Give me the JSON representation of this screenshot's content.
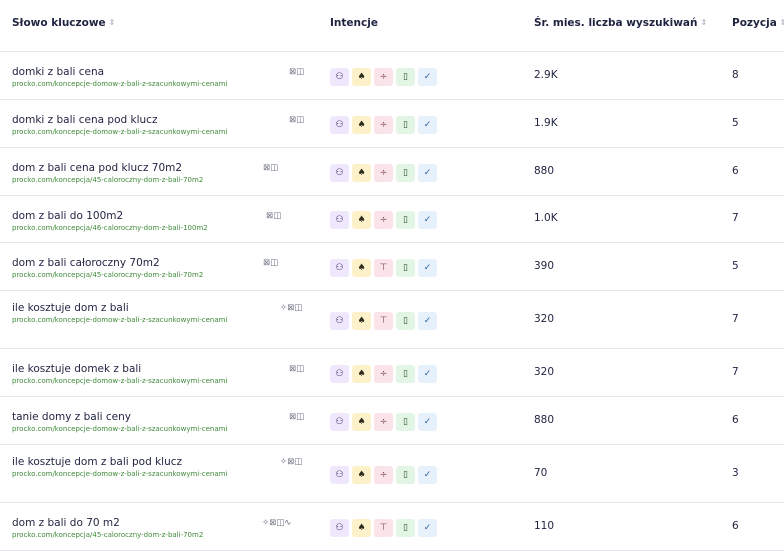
{
  "headers": {
    "keyword": "Słowo kluczowe",
    "intent": "Intencje",
    "volume": "Śr. mies. liczba wyszukiwań",
    "position": "Pozycja"
  },
  "intent_icons": [
    {
      "icon": "person-search-icon",
      "glyph": "⚇"
    },
    {
      "icon": "tree-icon",
      "glyph": "♠"
    },
    {
      "icon": "divide-icon",
      "glyph": "÷"
    },
    {
      "icon": "phone-icon",
      "glyph": "▯"
    },
    {
      "icon": "double-check-icon",
      "glyph": "✓"
    }
  ],
  "rows": [
    {
      "keyword": "domki z bali cena",
      "url": "procko.com/koncepcje-domow-z-bali-z-szacunkowymi-cenami",
      "features": "⊠◫",
      "volume": "2.9K",
      "position": "8",
      "third_intent": "÷"
    },
    {
      "keyword": "domki z bali cena pod klucz",
      "url": "procko.com/koncepcje-domow-z-bali-z-szacunkowymi-cenami",
      "features": "⊠◫",
      "volume": "1.9K",
      "position": "5",
      "third_intent": "÷"
    },
    {
      "keyword": "dom z bali cena pod klucz 70m2",
      "url": "procko.com/koncepcja/45-caloroczny-dom-z-bali-70m2",
      "features": "⊠◫",
      "volume": "880",
      "position": "6",
      "third_intent": "÷"
    },
    {
      "keyword": "dom z bali do 100m2",
      "url": "procko.com/koncepcja/46-caloroczny-dom-z-bali-100m2",
      "features": "⊠◫",
      "volume": "1.0K",
      "position": "7",
      "third_intent": "÷"
    },
    {
      "keyword": "dom z bali całoroczny 70m2",
      "url": "procko.com/koncepcja/45-caloroczny-dom-z-bali-70m2",
      "features": "⊠◫",
      "volume": "390",
      "position": "5",
      "third_intent": "⊤"
    },
    {
      "keyword": "ile kosztuje dom z bali",
      "url": "procko.com/koncepcje-domow-z-bali-z-szacunkowymi-cenami",
      "features": "✧⊠◫",
      "volume": "320",
      "position": "7",
      "third_intent": "⊤"
    },
    {
      "keyword": "ile kosztuje domek z bali",
      "url": "procko.com/koncepcje-domow-z-bali-z-szacunkowymi-cenami",
      "features": "⊠◫",
      "volume": "320",
      "position": "7",
      "third_intent": "÷"
    },
    {
      "keyword": "tanie domy z bali ceny",
      "url": "procko.com/koncepcje-domow-z-bali-z-szacunkowymi-cenami",
      "features": "⊠◫",
      "volume": "880",
      "position": "6",
      "third_intent": "÷"
    },
    {
      "keyword": "ile kosztuje dom z bali pod klucz",
      "url": "procko.com/koncepcje-domow-z-bali-z-szacunkowymi-cenami",
      "features": "✧⊠◫",
      "volume": "70",
      "position": "3",
      "third_intent": "÷"
    },
    {
      "keyword": "dom z bali do 70 m2",
      "url": "procko.com/koncepcja/45-caloroczny-dom-z-bali-70m2",
      "features": "✧⊠◫∿",
      "volume": "110",
      "position": "6",
      "third_intent": "⊤"
    }
  ],
  "colors": {
    "url_green": "#3f8a3a",
    "text": "#1f2340",
    "divider": "#e4e5ea"
  }
}
